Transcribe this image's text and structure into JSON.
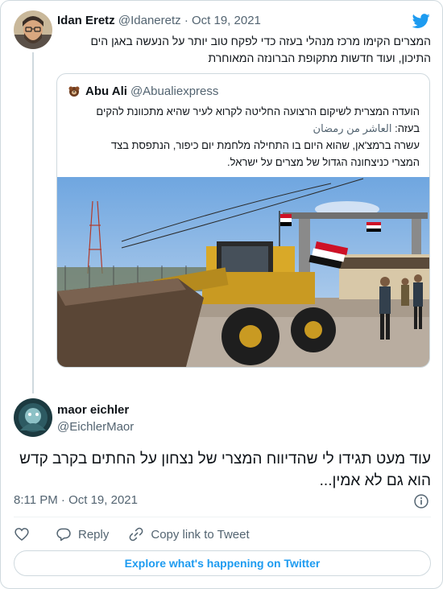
{
  "parent_tweet": {
    "name": "Idan Eretz",
    "handle": "@Idaneretz",
    "separator": "·",
    "date": "Oct 19, 2021",
    "text_line1": "המצרים הקימו מרכז מנהלי בעזה כדי לפקח טוב יותר על הנעשה באגן הים",
    "text_line2": "התיכון, ועוד חדשות מתקופת הברונזה המאוחרת"
  },
  "quoted_tweet": {
    "name": "Abu Ali",
    "handle": "@Abualiexpress",
    "text_line1": "הועדה המצרית לשיקום הרצועה החליטה לקרוא לעיר שהיא מתכוונת להקים",
    "text_line2_prefix": "בעזה: ",
    "text_line2_arabic": "العاشر من رمضان",
    "text_line3": "עשרה ברמצ'אן, שהוא היום בו התחילה מלחמת יום כיפור, הנתפסת בצד",
    "text_line4": "המצרי כניצחונה הגדול של מצרים על ישראל."
  },
  "main_tweet": {
    "name": "maor eichler",
    "handle": "@EichlerMaor",
    "text_line1": "עוד מעט תגידו לי שהדיווח המצרי של נצחון על החתים בקרב קדש",
    "text_line2": "הוא גם לא אמין...",
    "timestamp": "8:11 PM · Oct 19, 2021"
  },
  "actions": {
    "reply_label": "Reply",
    "copy_link_label": "Copy link to Tweet"
  },
  "explore_label": "Explore what's happening on Twitter",
  "colors": {
    "accent": "#1d9bf0",
    "secondary_text": "#536471",
    "border": "#cfd9de"
  },
  "icons": [
    "twitter-bird-icon",
    "heart-icon",
    "reply-icon",
    "link-icon",
    "info-icon"
  ]
}
